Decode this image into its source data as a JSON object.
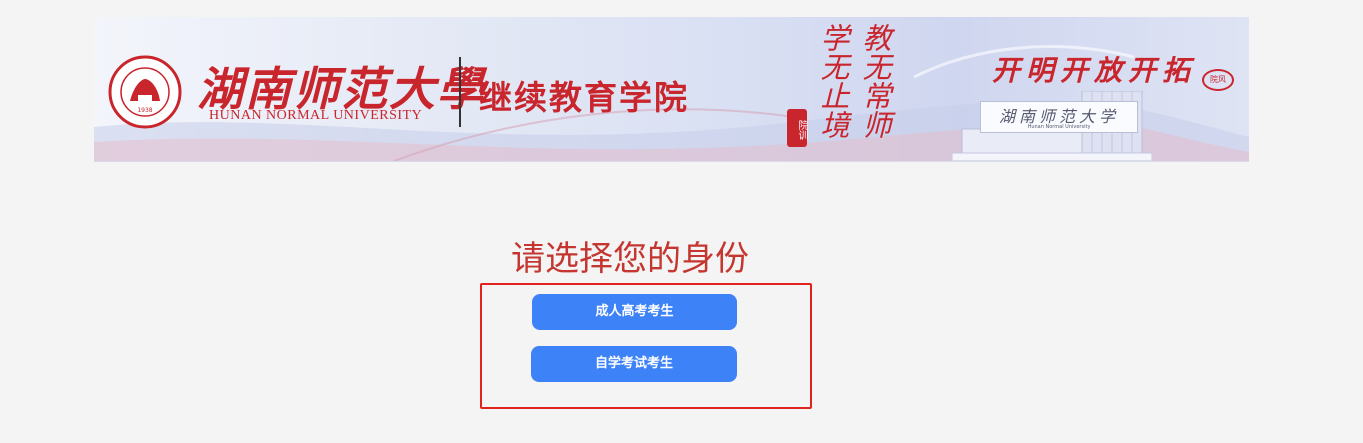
{
  "banner": {
    "university_cn": "湖南师范大學",
    "university_en": "HUNAN NORMAL UNIVERSITY",
    "college_name": "继续教育学院",
    "seal_year": "1938",
    "motto_col1": "学无止境",
    "motto_col2": "教无常师",
    "motto_stamp": "院训",
    "slogan": "开明开放开拓",
    "slogan_seal": "院风",
    "gate_sign_cn": "湖南师范大学",
    "gate_sign_en": "Hunan Normal University"
  },
  "main": {
    "title": "请选择您的身份",
    "buttons": [
      {
        "label": "成人高考考生"
      },
      {
        "label": "自学考试考生"
      }
    ]
  },
  "colors": {
    "brand_red": "#c9252c",
    "button_blue": "#3e82f7",
    "highlight_border": "#e0231f",
    "page_background": "#f4f4f4"
  }
}
